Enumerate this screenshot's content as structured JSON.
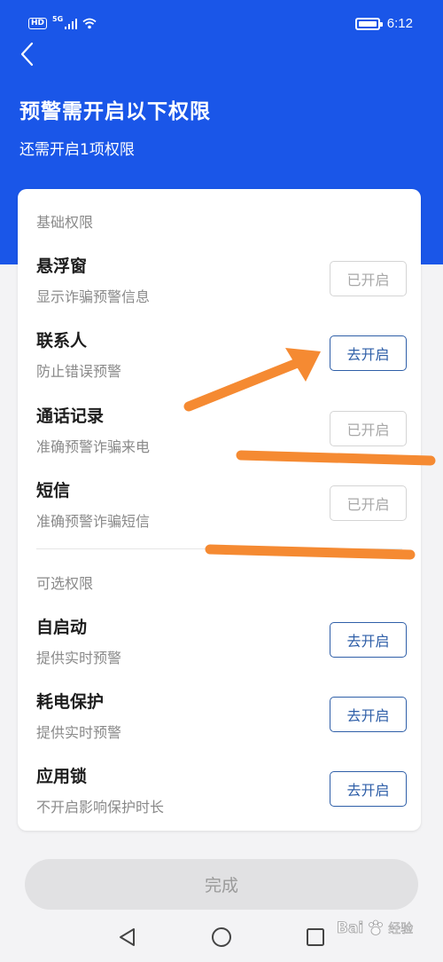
{
  "status_bar": {
    "hd_label": "HD",
    "network_label": "5G",
    "time": "6:12"
  },
  "header": {
    "title": "预警需开启以下权限",
    "subtitle": "还需开启1项权限"
  },
  "basic_section": {
    "title": "基础权限",
    "items": [
      {
        "name": "悬浮窗",
        "desc": "显示诈骗预警信息",
        "button": "已开启",
        "enabled": true
      },
      {
        "name": "联系人",
        "desc": "防止错误预警",
        "button": "去开启",
        "enabled": false
      },
      {
        "name": "通话记录",
        "desc": "准确预警诈骗来电",
        "button": "已开启",
        "enabled": true
      },
      {
        "name": "短信",
        "desc": "准确预警诈骗短信",
        "button": "已开启",
        "enabled": true
      }
    ]
  },
  "optional_section": {
    "title": "可选权限",
    "items": [
      {
        "name": "自启动",
        "desc": "提供实时预警",
        "button": "去开启",
        "enabled": false
      },
      {
        "name": "耗电保护",
        "desc": "提供实时预警",
        "button": "去开启",
        "enabled": false
      },
      {
        "name": "应用锁",
        "desc": "不开启影响保护时长",
        "button": "去开启",
        "enabled": false
      }
    ]
  },
  "footer": {
    "done_label": "完成"
  },
  "watermark": {
    "text": "Bai",
    "sub": "经验"
  },
  "colors": {
    "header_blue": "#1a56e8",
    "action_blue": "#2f5fa8",
    "annotation_orange": "#f58a32"
  },
  "icons": {
    "back": "chevron-left-icon",
    "nav_back": "triangle-back-icon",
    "nav_home": "circle-home-icon",
    "nav_recent": "square-recent-icon"
  }
}
